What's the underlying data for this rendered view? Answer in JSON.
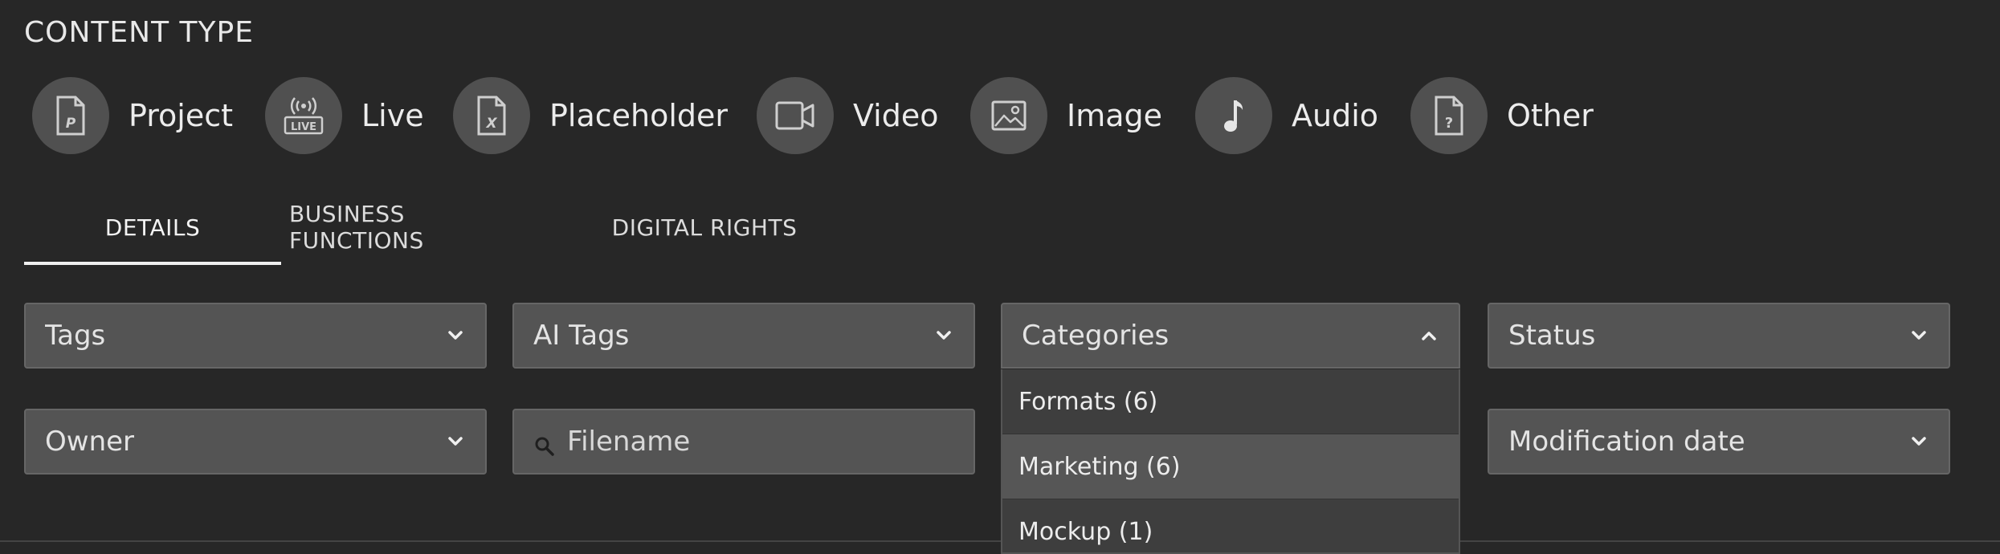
{
  "section_title": "CONTENT TYPE",
  "content_types": [
    {
      "label": "Project",
      "icon": "project-file-icon"
    },
    {
      "label": "Live",
      "icon": "live-broadcast-icon"
    },
    {
      "label": "Placeholder",
      "icon": "placeholder-file-icon"
    },
    {
      "label": "Video",
      "icon": "video-camera-icon"
    },
    {
      "label": "Image",
      "icon": "image-icon"
    },
    {
      "label": "Audio",
      "icon": "music-note-icon"
    },
    {
      "label": "Other",
      "icon": "unknown-file-icon"
    }
  ],
  "tabs": [
    {
      "label": "DETAILS",
      "active": true
    },
    {
      "label": "BUSINESS FUNCTIONS",
      "active": false
    },
    {
      "label": "DIGITAL RIGHTS",
      "active": false
    }
  ],
  "filters": {
    "tags": "Tags",
    "ai_tags": "AI Tags",
    "categories": "Categories",
    "status": "Status",
    "owner": "Owner",
    "filename_placeholder": "Filename",
    "modification_date": "Modification date"
  },
  "categories_dropdown": [
    {
      "label": "Formats (6)"
    },
    {
      "label": "Marketing (6)"
    },
    {
      "label": "Mockup (1)"
    }
  ],
  "colors": {
    "background": "#272727",
    "field": "#545454",
    "accent": "#f0f0f0"
  }
}
